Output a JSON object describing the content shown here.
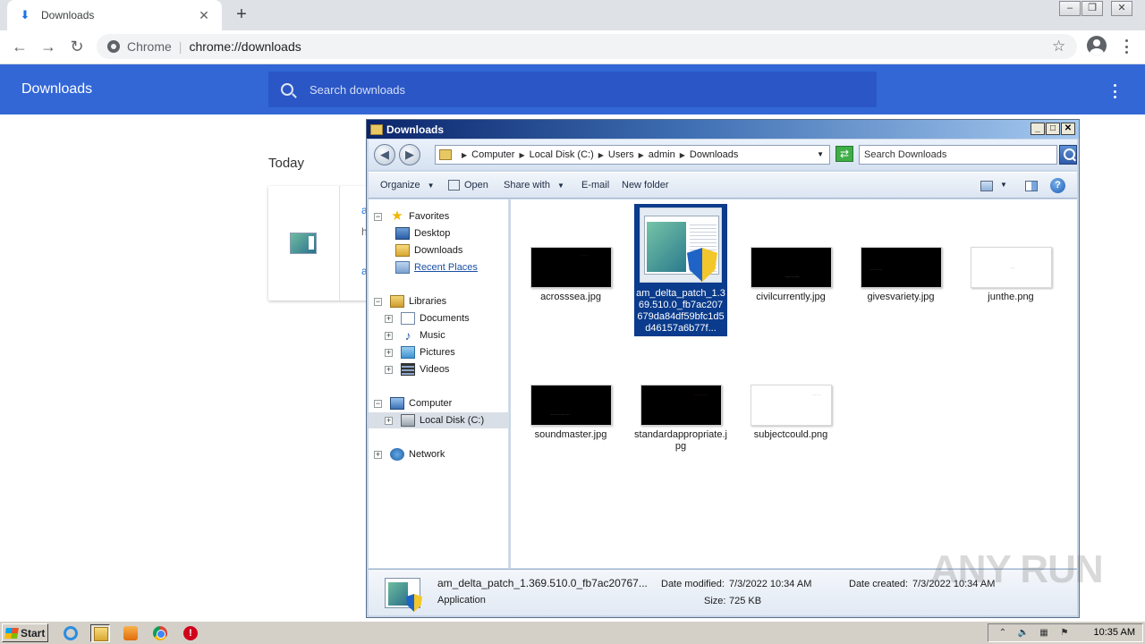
{
  "browser": {
    "tab": {
      "title": "Downloads"
    },
    "omnibox": {
      "site_name": "Chrome",
      "separator": "|",
      "url": "chrome://downloads"
    }
  },
  "downloads_page": {
    "title": "Downloads",
    "search_placeholder": "Search downloads",
    "section": "Today",
    "card_fragments": [
      "a",
      "h",
      "a"
    ]
  },
  "explorer": {
    "title": "Downloads",
    "breadcrumb": [
      "Computer",
      "Local Disk (C:)",
      "Users",
      "admin",
      "Downloads"
    ],
    "search_placeholder": "Search Downloads",
    "commands": {
      "organize": "Organize",
      "open": "Open",
      "share_with": "Share with",
      "email": "E-mail",
      "new_folder": "New folder"
    },
    "nav": {
      "favorites": "Favorites",
      "desktop": "Desktop",
      "downloads": "Downloads",
      "recent_places": "Recent Places",
      "libraries": "Libraries",
      "documents": "Documents",
      "music": "Music",
      "pictures": "Pictures",
      "videos": "Videos",
      "computer": "Computer",
      "local_disk": "Local Disk (C:)",
      "network": "Network"
    },
    "files": [
      {
        "name": "acrosssea.jpg",
        "thumb": "dark"
      },
      {
        "name": "am_delta_patch_1.369.510.0_fb7ac207679da84df59bfc1d5d46157a6b77f...",
        "thumb": "app",
        "selected": true
      },
      {
        "name": "civilcurrently.jpg",
        "thumb": "dark"
      },
      {
        "name": "givesvariety.jpg",
        "thumb": "dark"
      },
      {
        "name": "junthe.png",
        "thumb": "light"
      },
      {
        "name": "soundmaster.jpg",
        "thumb": "dark"
      },
      {
        "name": "standardappropriate.jpg",
        "thumb": "dark"
      },
      {
        "name": "subjectcould.png",
        "thumb": "light"
      }
    ],
    "details": {
      "name": "am_delta_patch_1.369.510.0_fb7ac20767...",
      "type": "Application",
      "date_modified_label": "Date modified:",
      "date_modified": "7/3/2022 10:34 AM",
      "size_label": "Size:",
      "size": "725 KB",
      "date_created_label": "Date created:",
      "date_created": "7/3/2022 10:34 AM"
    }
  },
  "taskbar": {
    "start_label": "Start",
    "clock": "10:35 AM"
  },
  "watermark": "ANY RUN",
  "colors": {
    "chrome_header": "#3367d6",
    "explorer_selection": "#0a3b8c"
  }
}
